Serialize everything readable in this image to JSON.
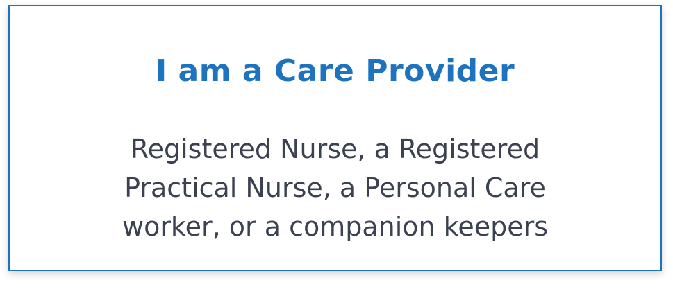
{
  "card": {
    "title": "I am a Care Provider",
    "description_lines": [
      "Registered Nurse, a Registered",
      "Practical Nurse, a Personal Care",
      "worker, or a companion keepers"
    ]
  },
  "colors": {
    "accent": "#1e73be",
    "text": "#3a4150",
    "background": "#ffffff"
  }
}
